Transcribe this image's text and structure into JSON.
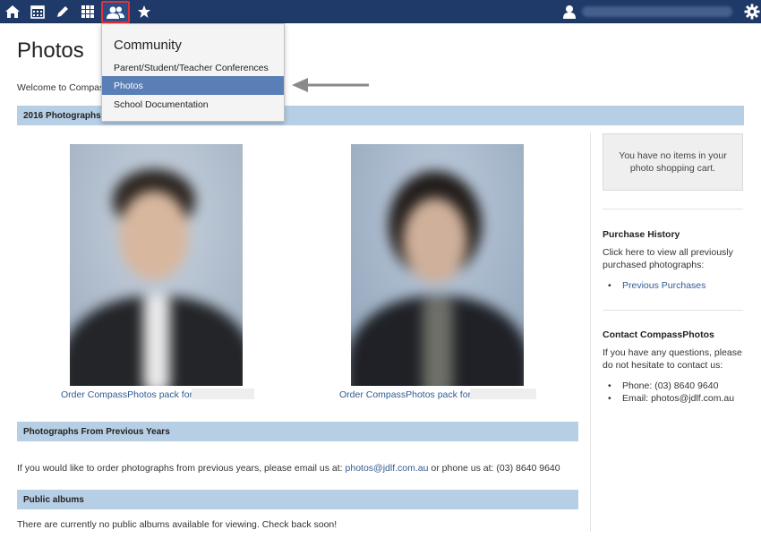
{
  "nav": {
    "icons": [
      "home-icon",
      "calendar-icon",
      "pencil-icon",
      "apps-grid-icon",
      "community-people-icon",
      "star-icon",
      "user-icon",
      "gear-icon"
    ],
    "active": "community-people-icon",
    "highlight_color": "#e5303a"
  },
  "page": {
    "title": "Photos",
    "welcome": "Welcome to Compass"
  },
  "dropdown": {
    "title": "Community",
    "items": [
      {
        "label": "Parent/Student/Teacher Conferences",
        "selected": false
      },
      {
        "label": "Photos",
        "selected": true
      },
      {
        "label": "School Documentation",
        "selected": false
      }
    ]
  },
  "sections": {
    "current": "2016 Photographs",
    "previous": "Photographs From Previous Years",
    "albums": "Public albums"
  },
  "photos": [
    {
      "order_label": "Order CompassPhotos pack for"
    },
    {
      "order_label": "Order CompassPhotos pack for"
    }
  ],
  "previous_years": {
    "text_before": "If you would like to order photographs from previous years, please email us at:",
    "email": "photos@jdlf.com.au",
    "text_after": "or phone us at: (03) 8640 9640"
  },
  "albums_text": "There are currently no public albums available for viewing. Check back soon!",
  "sidebar": {
    "cart_text": "You have no items in your photo shopping cart.",
    "purchase_history": {
      "title": "Purchase History",
      "text": "Click here to view all previously purchased photographs:",
      "link": "Previous Purchases"
    },
    "contact": {
      "title": "Contact CompassPhotos",
      "text": "If you have any questions, please do not hesitate to contact us:",
      "phone": "Phone: (03) 8640 9640",
      "email": "Email: photos@jdlf.com.au"
    }
  },
  "colors": {
    "topbar": "#1f3a68",
    "section_bar": "#b7cfe5",
    "link": "#305b94",
    "dropdown_selected": "#5a7fb6"
  }
}
